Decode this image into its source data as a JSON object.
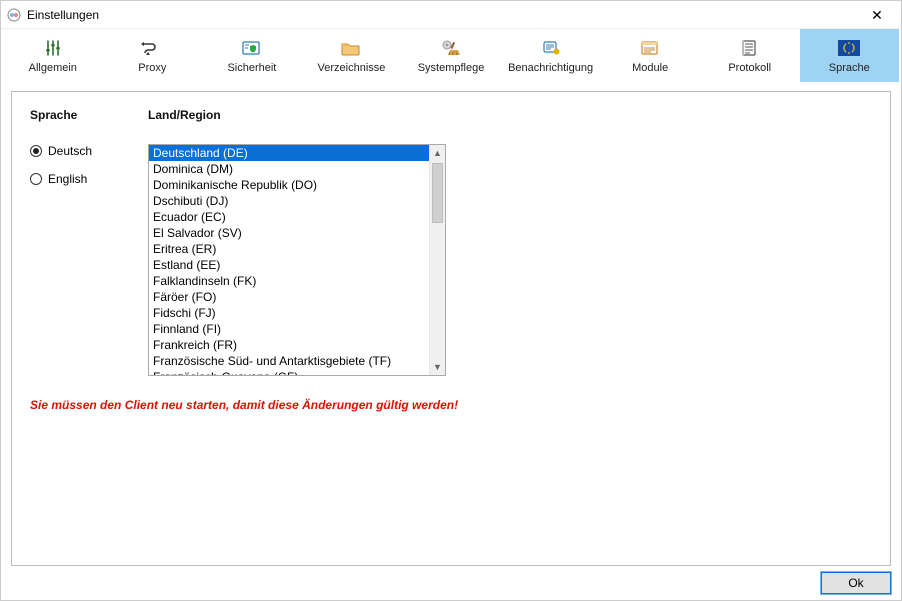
{
  "window": {
    "title": "Einstellungen"
  },
  "tabs": [
    {
      "id": "allgemein",
      "label": "Allgemein"
    },
    {
      "id": "proxy",
      "label": "Proxy"
    },
    {
      "id": "sicherheit",
      "label": "Sicherheit"
    },
    {
      "id": "verzeichnisse",
      "label": "Verzeichnisse"
    },
    {
      "id": "systempflege",
      "label": "Systempflege"
    },
    {
      "id": "benachrichtigung",
      "label": "Benachrichtigung"
    },
    {
      "id": "module",
      "label": "Module"
    },
    {
      "id": "protokoll",
      "label": "Protokoll"
    },
    {
      "id": "sprache",
      "label": "Sprache"
    }
  ],
  "selected_tab": "sprache",
  "section": {
    "lang_header": "Sprache",
    "region_header": "Land/Region",
    "radios": {
      "deutsch": "Deutsch",
      "english": "English",
      "selected": "deutsch"
    },
    "countries": [
      "Deutschland (DE)",
      "Dominica (DM)",
      "Dominikanische Republik (DO)",
      "Dschibuti (DJ)",
      "Ecuador (EC)",
      "El Salvador (SV)",
      "Eritrea (ER)",
      "Estland (EE)",
      "Falklandinseln (FK)",
      "Färöer (FO)",
      "Fidschi (FJ)",
      "Finnland (FI)",
      "Frankreich (FR)",
      "Französische Süd- und Antarktisgebiete (TF)",
      "Französisch-Guayana (GF)"
    ],
    "selected_country_index": 0
  },
  "notice": "Sie müssen den Client neu starten, damit diese Änderungen gültig werden!",
  "buttons": {
    "ok": "Ok"
  }
}
